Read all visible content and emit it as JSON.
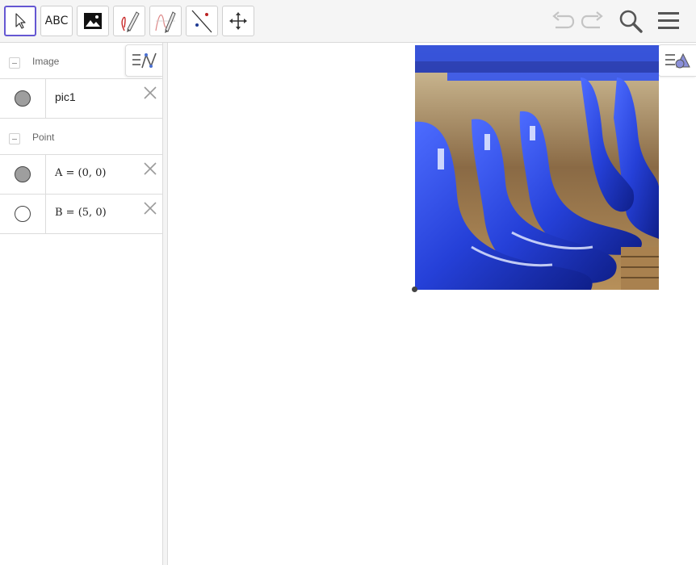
{
  "toolbar": {
    "tools": [
      {
        "name": "move",
        "icon": "cursor-arrow-icon",
        "active": true
      },
      {
        "name": "text",
        "label": "ABC"
      },
      {
        "name": "image",
        "icon": "image-icon"
      },
      {
        "name": "pen",
        "icon": "pen-icon"
      },
      {
        "name": "freehand-function",
        "icon": "freehand-function-icon"
      },
      {
        "name": "line",
        "icon": "line-through-points-icon"
      },
      {
        "name": "move-graphics-view",
        "icon": "move-graphics-view-icon"
      }
    ],
    "undo_icon": "undo-icon",
    "redo_icon": "redo-icon",
    "search_icon": "search-icon",
    "menu_icon": "menu-icon",
    "accent_color": "#6557d2"
  },
  "algebra": {
    "groups": [
      {
        "label": "Image",
        "items": [
          {
            "expression": "pic1",
            "marble": "filled"
          }
        ]
      },
      {
        "label": "Point",
        "items": [
          {
            "expression": "A = (0, 0)",
            "marble": "filled"
          },
          {
            "expression": "B = (5, 0)",
            "marble": "empty"
          }
        ]
      }
    ]
  },
  "graphics": {
    "picture_name": "pic1",
    "picture_description_icon": "stadium-blue-seats-image"
  }
}
